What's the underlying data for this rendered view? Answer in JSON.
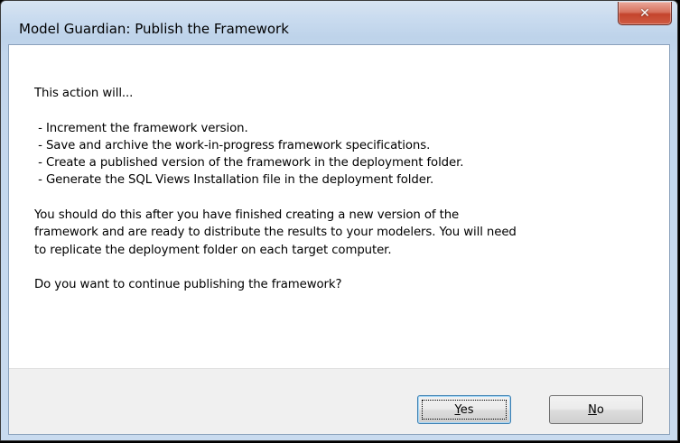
{
  "window": {
    "title": "Model Guardian: Publish the Framework",
    "close_icon": "close-icon"
  },
  "message": {
    "text": "This action will...\n\n - Increment the framework version.\n - Save and archive the work-in-progress framework specifications.\n - Create a published version of the framework in the deployment folder.\n - Generate the SQL Views Installation file in the deployment folder.\n\nYou should do this after you have finished creating a new version of the\nframework and are ready to distribute the results to your modelers. You will need\nto replicate the deployment folder on each target computer.\n\nDo you want to continue publishing the framework?"
  },
  "buttons": {
    "yes": {
      "mnemonic": "Y",
      "rest": "es"
    },
    "no": {
      "mnemonic": "N",
      "rest": "o"
    }
  },
  "colors": {
    "close_button": "#c4442d",
    "default_button_border": "#3c7fb1",
    "button_bar": "#f0f0f0"
  }
}
